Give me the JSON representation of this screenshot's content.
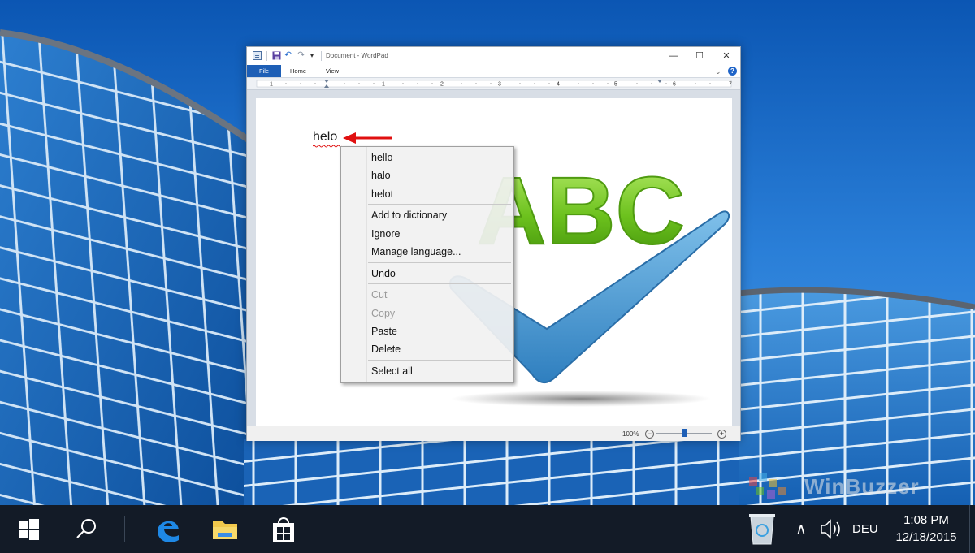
{
  "window": {
    "title": "Document - WordPad",
    "minimize_glyph": "—",
    "maximize_glyph": "☐",
    "close_glyph": "✕",
    "tabs": [
      {
        "label": "File"
      },
      {
        "label": "Home"
      },
      {
        "label": "View"
      }
    ],
    "help_glyph": "?",
    "chevron_glyph": "⌄"
  },
  "ruler": {
    "numbers": [
      "1",
      "1",
      "2",
      "3",
      "4",
      "5",
      "6",
      "7"
    ]
  },
  "document": {
    "text": "helo"
  },
  "context_menu": {
    "items": [
      {
        "label": "hello",
        "enabled": true
      },
      {
        "label": "halo",
        "enabled": true
      },
      {
        "label": "helot",
        "enabled": true
      },
      {
        "label": "Add to dictionary",
        "enabled": true
      },
      {
        "label": "Ignore",
        "enabled": true
      },
      {
        "label": "Manage language...",
        "enabled": true
      },
      {
        "label": "Undo",
        "enabled": true
      },
      {
        "label": "Cut",
        "enabled": false
      },
      {
        "label": "Copy",
        "enabled": false
      },
      {
        "label": "Paste",
        "enabled": true
      },
      {
        "label": "Delete",
        "enabled": true
      },
      {
        "label": "Select all",
        "enabled": true
      }
    ]
  },
  "status_bar": {
    "zoom_level": "100%",
    "zoom_out": "−",
    "zoom_in": "+"
  },
  "logo": {
    "text": "ABC"
  },
  "taskbar": {
    "language": "DEU",
    "time": "1:08 PM",
    "date": "12/18/2015",
    "tray_chevron": "∧"
  },
  "watermark": {
    "text": "WinBuzzer"
  },
  "colors": {
    "accent": "#1e5fb6",
    "taskbar": "#131b27",
    "logo_green": "#6cc11d",
    "check_blue": "#3d8cc7",
    "arrow_red": "#e01010"
  }
}
